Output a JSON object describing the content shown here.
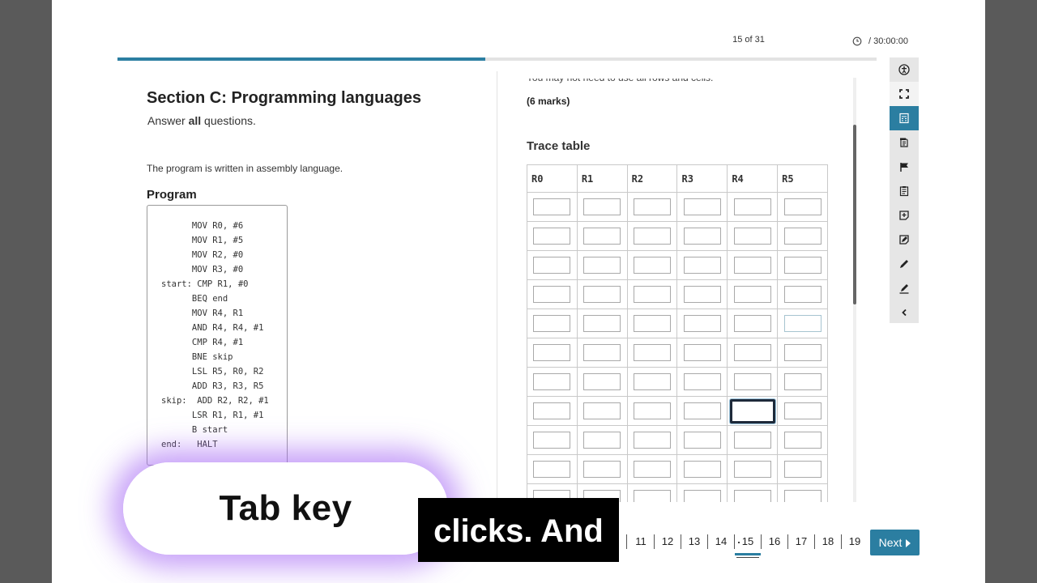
{
  "header": {
    "counter": "15 of 31",
    "timer": "/ 30:00:00",
    "progress": 0.485
  },
  "left": {
    "section_title": "Section C: Programming languages",
    "instructions_prefix": "Answer ",
    "instructions_bold": "all",
    "instructions_suffix": " questions.",
    "intro": "The program is written in assembly language.",
    "program_heading": "Program",
    "program_lines": [
      "      MOV R0, #6",
      "      MOV R1, #5",
      "      MOV R2, #0",
      "      MOV R3, #0",
      "start: CMP R1, #0",
      "      BEQ end",
      "      MOV R4, R1",
      "      AND R4, R4, #1",
      "      CMP R4, #1",
      "      BNE skip",
      "      LSL R5, R0, R2",
      "      ADD R3, R3, R5",
      "skip:  ADD R2, R2, #1",
      "      LSR R1, R1, #1",
      "      B start",
      "end:   HALT"
    ]
  },
  "right": {
    "cut_text": "You may not need to use all rows and cells.",
    "marks": "(6 marks)",
    "trace_heading": "Trace table",
    "columns": [
      "R0",
      "R1",
      "R2",
      "R3",
      "R4",
      "R5"
    ],
    "row_count": 11,
    "focused_cell": {
      "row": 7,
      "col": 4
    }
  },
  "toolbar": {
    "tools": [
      "accessibility-icon",
      "fullscreen-icon",
      "calculator-icon",
      "formula-sheet-icon",
      "flag-icon",
      "notepad-icon",
      "add-note-icon",
      "edit-note-icon",
      "pencil-icon",
      "highlighter-icon",
      "chevron-left-icon"
    ],
    "active_tool": "calculator-icon"
  },
  "pager": {
    "pages": [
      "11",
      "12",
      "13",
      "14",
      "15",
      "16",
      "17",
      "18",
      "19"
    ],
    "current": "15",
    "next_label": "Next"
  },
  "overlay": {
    "pill_text": "Tab key",
    "caption_text": "clicks. And"
  }
}
